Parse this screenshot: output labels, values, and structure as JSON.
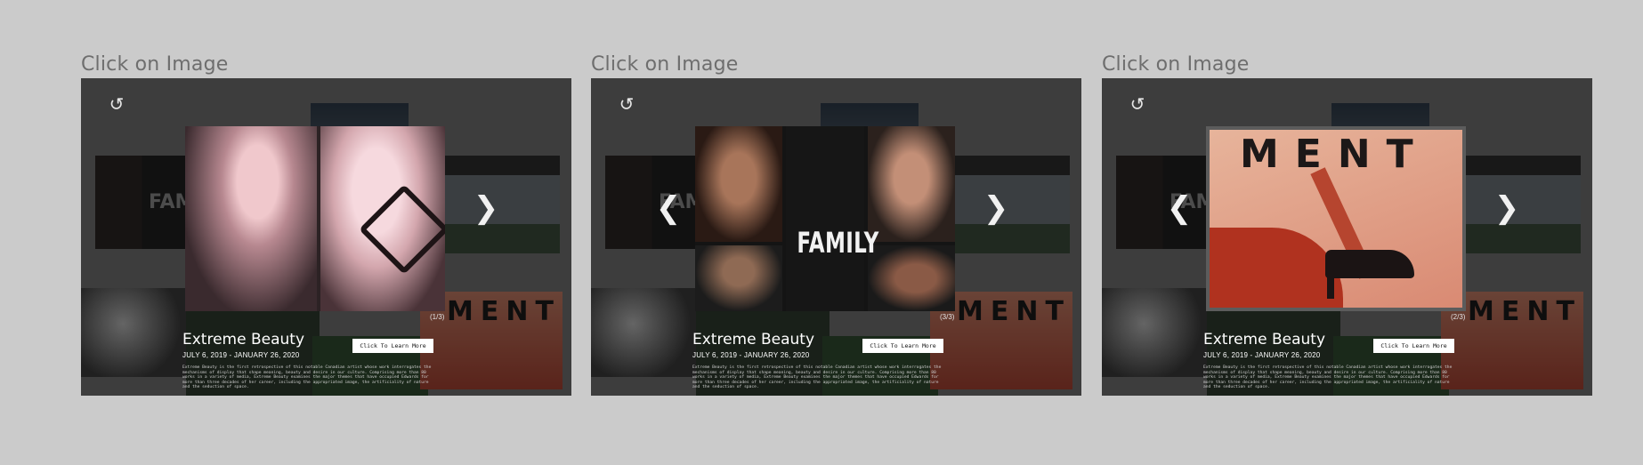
{
  "panels": [
    {
      "label": "Click on Image",
      "counter": "(1/3)",
      "title": "Extreme Beauty",
      "dates": "JULY 6, 2019 - JANUARY 26, 2020",
      "button": "Click To Learn More",
      "description": "Extreme Beauty is the first retrospective of this notable Canadian artist whose work interrogates the mechanisms of display that shape meaning, beauty and desire in our culture. Comprising more than 80 works in a variety of media, Extreme Beauty examines the major themes that have occupied Edwards for more than three decades of her career, including the appropriated image, the artificiality of nature and the seduction of space.",
      "background_texts": {
        "family": "FAMIL",
        "ment": "MENT"
      },
      "show_prev": false,
      "show_next": true,
      "image": "two-pink-portraits"
    },
    {
      "label": "Click on Image",
      "counter": "(3/3)",
      "title": "Extreme Beauty",
      "dates": "JULY 6, 2019 - JANUARY 26, 2020",
      "button": "Click To Learn More",
      "description": "Extreme Beauty is the first retrospective of this notable Canadian artist whose work interrogates the mechanisms of display that shape meaning, beauty and desire in our culture. Comprising more than 80 works in a variety of media, Extreme Beauty examines the major themes that have occupied Edwards for more than three decades of her career, including the appropriated image, the artificiality of nature and the seduction of space.",
      "background_texts": {
        "family": "FAMIL",
        "ment": "MENT"
      },
      "image_text": "FAMILY",
      "show_prev": true,
      "show_next": true,
      "image": "family-collage"
    },
    {
      "label": "Click on Image",
      "counter": "(2/3)",
      "title": "Extreme Beauty",
      "dates": "JULY 6, 2019 - JANUARY 26, 2020",
      "button": "Click To Learn More",
      "description": "Extreme Beauty is the first retrospective of this notable Canadian artist whose work interrogates the mechanisms of display that shape meaning, beauty and desire in our culture. Comprising more than 80 works in a variety of media, Extreme Beauty examines the major themes that have occupied Edwards for more than three decades of her career, including the appropriated image, the artificiality of nature and the seduction of space.",
      "background_texts": {
        "family": "FAMIL",
        "ment": "MENT"
      },
      "image_text": "MENT",
      "show_prev": true,
      "show_next": true,
      "image": "shoe-poster"
    }
  ],
  "icons": {
    "back": "undo-arrow-icon",
    "prev": "chevron-left-icon",
    "next": "chevron-right-icon"
  },
  "colors": {
    "page_bg": "#cbcbcb",
    "viewer_bg": "#3d3d3d",
    "button_bg": "#ffffff",
    "label": "#6e6e6e"
  }
}
